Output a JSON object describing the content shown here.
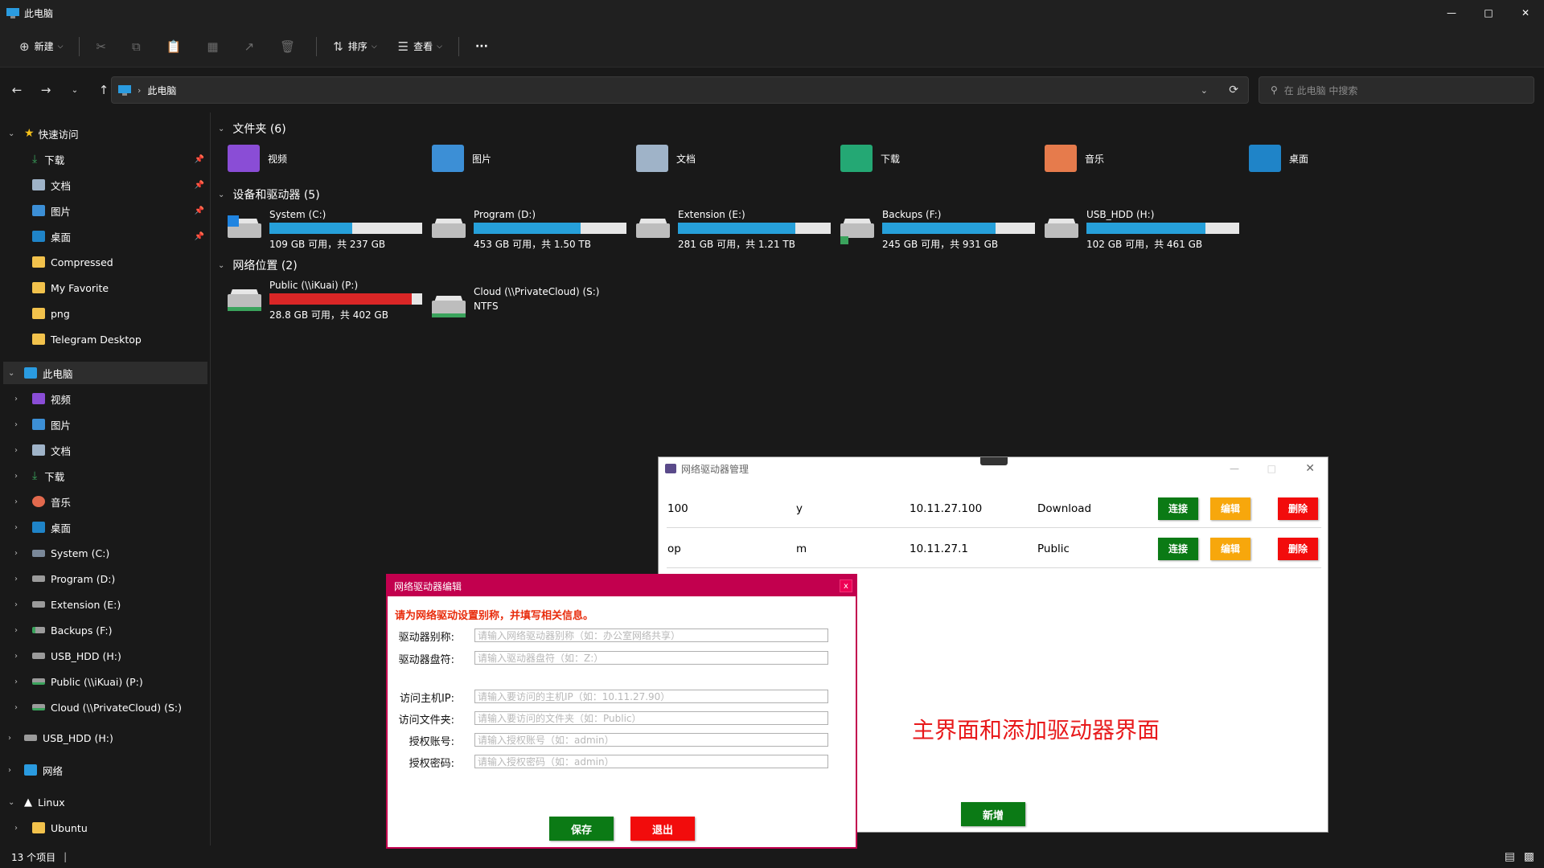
{
  "window": {
    "title": "此电脑"
  },
  "toolbar": {
    "new_label": "新建",
    "sort_label": "排序",
    "view_label": "查看",
    "more_label": "···"
  },
  "address": {
    "path": "此电脑",
    "search_placeholder": "在 此电脑 中搜索"
  },
  "sidebar": {
    "quick_access": "快速访问",
    "quick_items": [
      "下载",
      "文档",
      "图片",
      "桌面",
      "Compressed",
      "My Favorite",
      "png",
      "Telegram Desktop"
    ],
    "this_pc": "此电脑",
    "pc_items": [
      "视频",
      "图片",
      "文档",
      "下载",
      "音乐",
      "桌面",
      "System (C:)",
      "Program (D:)",
      "Extension (E:)",
      "Backups (F:)",
      "USB_HDD (H:)",
      "Public (\\\\iKuai) (P:)",
      "Cloud (\\\\PrivateCloud) (S:)"
    ],
    "usb": "USB_HDD (H:)",
    "network": "网络",
    "linux": "Linux",
    "ubuntu": "Ubuntu"
  },
  "sections": {
    "folders": "文件夹 (6)",
    "drives": "设备和驱动器 (5)",
    "netloc": "网络位置 (2)"
  },
  "folders": [
    "视频",
    "图片",
    "文档",
    "下载",
    "音乐",
    "桌面"
  ],
  "drives": [
    {
      "name": "System (C:)",
      "sub": "109 GB 可用，共 237 GB",
      "used": 0.54
    },
    {
      "name": "Program (D:)",
      "sub": "453 GB 可用，共 1.50 TB",
      "used": 0.7
    },
    {
      "name": "Extension (E:)",
      "sub": "281 GB 可用，共 1.21 TB",
      "used": 0.77
    },
    {
      "name": "Backups (F:)",
      "sub": "245 GB 可用，共 931 GB",
      "used": 0.74
    },
    {
      "name": "USB_HDD (H:)",
      "sub": "102 GB 可用，共 461 GB",
      "used": 0.78
    }
  ],
  "netdrives": [
    {
      "name": "Public (\\\\iKuai) (P:)",
      "sub": "28.8 GB 可用，共 402 GB",
      "used": 0.93
    },
    {
      "name": "Cloud (\\\\PrivateCloud) (S:)",
      "sub": "NTFS"
    }
  ],
  "status": {
    "count": "13 个项目",
    "sep": "|"
  },
  "manager": {
    "title": "网络驱动器管理",
    "rows": [
      {
        "alias": "100",
        "letter": "y",
        "ip": "10.11.27.100",
        "folder": "Download"
      },
      {
        "alias": "op",
        "letter": "m",
        "ip": "10.11.27.1",
        "folder": "Public"
      }
    ],
    "connect": "连接",
    "edit": "编辑",
    "delete": "删除",
    "caption": "主界面和添加驱动器界面",
    "add": "新增"
  },
  "editor": {
    "title": "网络驱动器编辑",
    "close": "x",
    "hint": "请为网络驱动设置别称，并填写相关信息。",
    "fields": [
      {
        "label": "驱动器别称:",
        "placeholder": "请输入网络驱动器别称（如：办公室网络共享）"
      },
      {
        "label": "驱动器盘符:",
        "placeholder": "请输入驱动器盘符（如：Z:）"
      },
      {
        "label": "访问主机IP:",
        "placeholder": "请输入要访问的主机IP（如：10.11.27.90）"
      },
      {
        "label": "访问文件夹:",
        "placeholder": "请输入要访问的文件夹（如：Public）"
      },
      {
        "label": "授权账号:",
        "placeholder": "请输入授权账号（如：admin）"
      },
      {
        "label": "授权密码:",
        "placeholder": "请输入授权密码（如：admin）"
      }
    ],
    "save": "保存",
    "exit": "退出"
  },
  "colors": {
    "accent": "#26a0da",
    "danger_bar": "#da2626",
    "green": "#0b7a15",
    "orange": "#f7a70c",
    "red": "#f20c0c",
    "editor_title": "#c2004e",
    "caption": "#e8191b"
  }
}
